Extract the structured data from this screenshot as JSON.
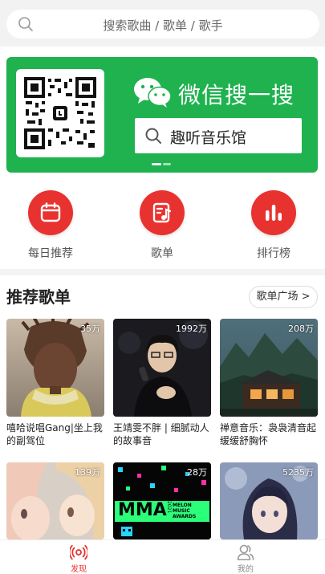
{
  "search": {
    "placeholder": "搜索歌曲 / 歌单 / 歌手"
  },
  "banner": {
    "title": "微信搜一搜",
    "search_text": "趣听音乐馆"
  },
  "shortcuts": [
    {
      "label": "每日推荐",
      "icon": "calendar-icon"
    },
    {
      "label": "歌单",
      "icon": "music-note-icon"
    },
    {
      "label": "排行榜",
      "icon": "bar-chart-icon"
    }
  ],
  "section": {
    "title": "推荐歌单",
    "more_label": "歌单广场 >"
  },
  "playlists": [
    {
      "count": "35万",
      "title": "嘻哈说唱Gang|坐上我的副驾位"
    },
    {
      "count": "1992万",
      "title": "王靖雯不胖 | 细腻动人的故事音"
    },
    {
      "count": "208万",
      "title": "禅意音乐：袅袅清音起 缓缓舒胸怀"
    },
    {
      "count": "139万",
      "title": ""
    },
    {
      "count": "28万",
      "title": ""
    },
    {
      "count": "5235万",
      "title": ""
    }
  ],
  "cover_texts": {
    "mma": "MMA",
    "year": "2021",
    "awards": "MELON MUSIC AWARDS"
  },
  "tabs": [
    {
      "label": "发现",
      "icon": "radio-icon",
      "active": true
    },
    {
      "label": "我的",
      "icon": "user-icon",
      "active": false
    }
  ],
  "colors": {
    "accent": "#e8322f",
    "wechat_green": "#1fb24f"
  }
}
